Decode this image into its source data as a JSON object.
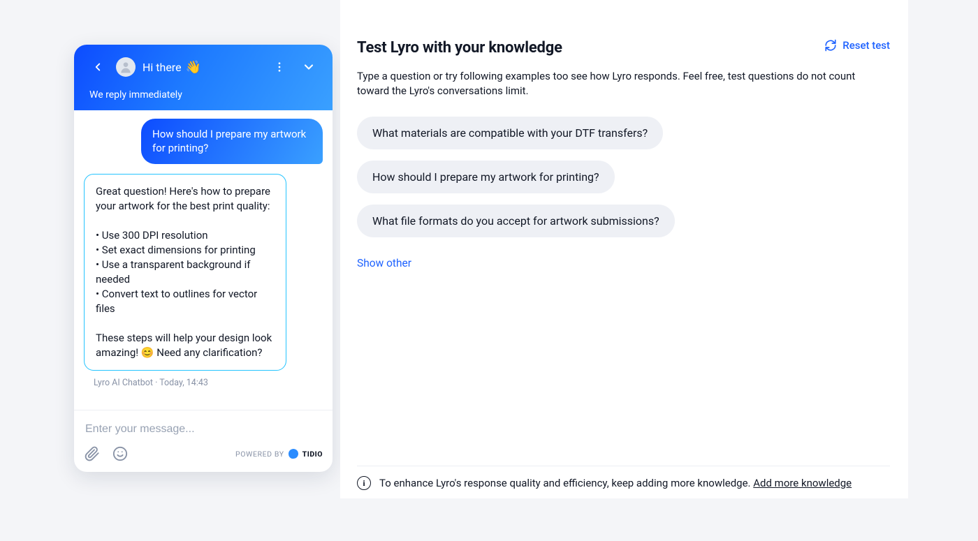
{
  "chat": {
    "greeting": "Hi there",
    "wave_emoji": "👋",
    "subtitle": "We reply immediately",
    "user_message": "How should I prepare my artwork for printing?",
    "bot_message": "Great question! Here's how to prepare your artwork for the best print quality:\n\n• Use 300 DPI resolution\n• Set exact dimensions for printing\n• Use a transparent background if needed\n• Convert text to outlines for vector files\n\nThese steps will help your design look amazing! 😊 Need any clarification?",
    "bot_meta": "Lyro AI Chatbot · Today, 14:43",
    "input_placeholder": "Enter your message...",
    "powered_by_label": "POWERED BY",
    "powered_by_brand": "TIDIO"
  },
  "panel": {
    "title": "Test Lyro with your knowledge",
    "reset_label": "Reset test",
    "description": "Type a question or try following examples too see how Lyro responds. Feel free, test questions do not count toward the Lyro's conversations limit.",
    "suggestions": [
      "What materials are compatible with your DTF transfers?",
      "How should I prepare my artwork for printing?",
      "What file formats do you accept for artwork submissions?"
    ],
    "show_other": "Show other",
    "footer_text": "To enhance Lyro's response quality and efficiency, keep adding more knowledge. ",
    "footer_link": "Add more knowledge"
  }
}
